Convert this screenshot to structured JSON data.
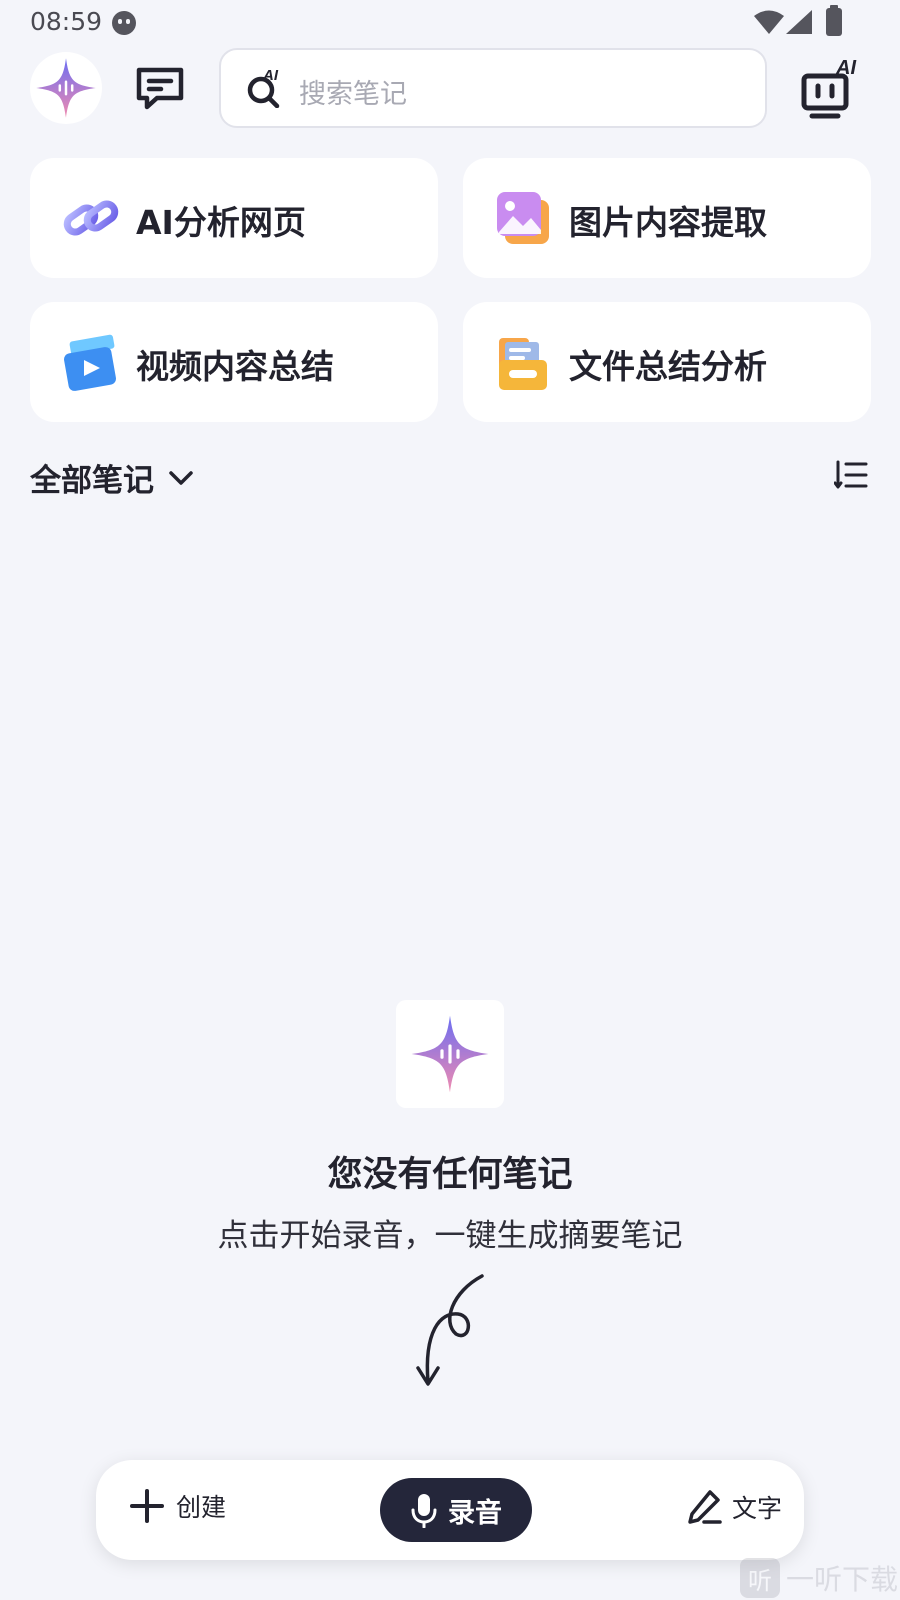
{
  "status_bar": {
    "time": "08:59"
  },
  "search": {
    "placeholder": "搜索笔记",
    "icon_badge": "AI"
  },
  "ai_device": {
    "badge": "AI"
  },
  "cards": [
    {
      "label": "AI分析网页",
      "icon": "link-chain-icon"
    },
    {
      "label": "图片内容提取",
      "icon": "image-icon"
    },
    {
      "label": "视频内容总结",
      "icon": "video-icon"
    },
    {
      "label": "文件总结分析",
      "icon": "folder-icon"
    }
  ],
  "notes_filter": {
    "label": "全部笔记"
  },
  "empty_state": {
    "title": "您没有任何笔记",
    "subtitle": "点击开始录音，一键生成摘要笔记"
  },
  "action_bar": {
    "create_label": "创建",
    "record_label": "录音",
    "text_label": "文字"
  },
  "watermark": {
    "badge": "听",
    "text": "一听下载"
  },
  "colors": {
    "background": "#f4f5fa",
    "record_button": "#24263a",
    "accent_gradient_start": "#6b6df2",
    "accent_gradient_end": "#f08bb0"
  }
}
